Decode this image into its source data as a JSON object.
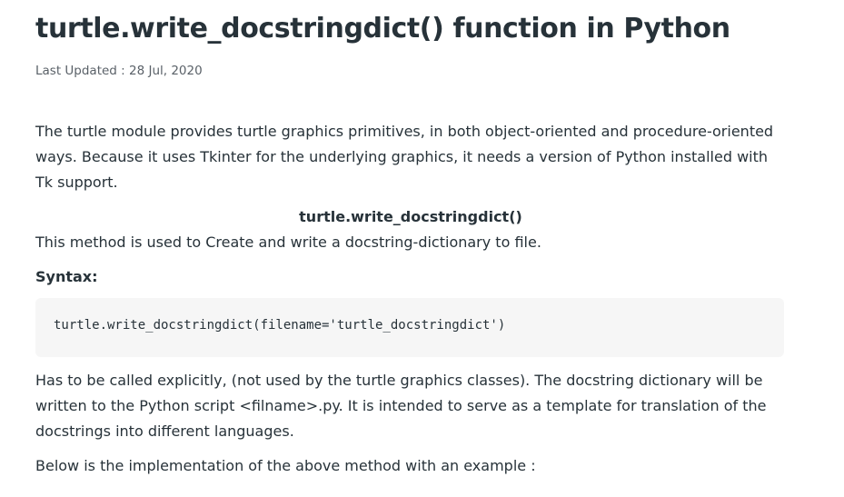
{
  "article": {
    "title": "turtle.write_docstringdict() function in Python",
    "last_updated": "Last Updated : 28 Jul, 2020",
    "intro": "The turtle module provides turtle graphics primitives, in both object-oriented and procedure-oriented ways. Because it uses Tkinter for the underlying graphics, it needs a version of Python installed with Tk support.",
    "method_heading": "turtle.write_docstringdict()",
    "method_description": "This method is used to Create and write a docstring-dictionary to file.",
    "syntax_label": "Syntax:",
    "syntax_code": "turtle.write_docstringdict(filename='turtle_docstringdict')",
    "explanation": "Has to be called explicitly, (not used by the turtle graphics classes). The docstring dictionary will be written to the Python script <filname>.py. It is intended to serve as a template for translation of the docstrings into different languages.",
    "example_intro": "Below is the implementation of the above method with an example :"
  }
}
